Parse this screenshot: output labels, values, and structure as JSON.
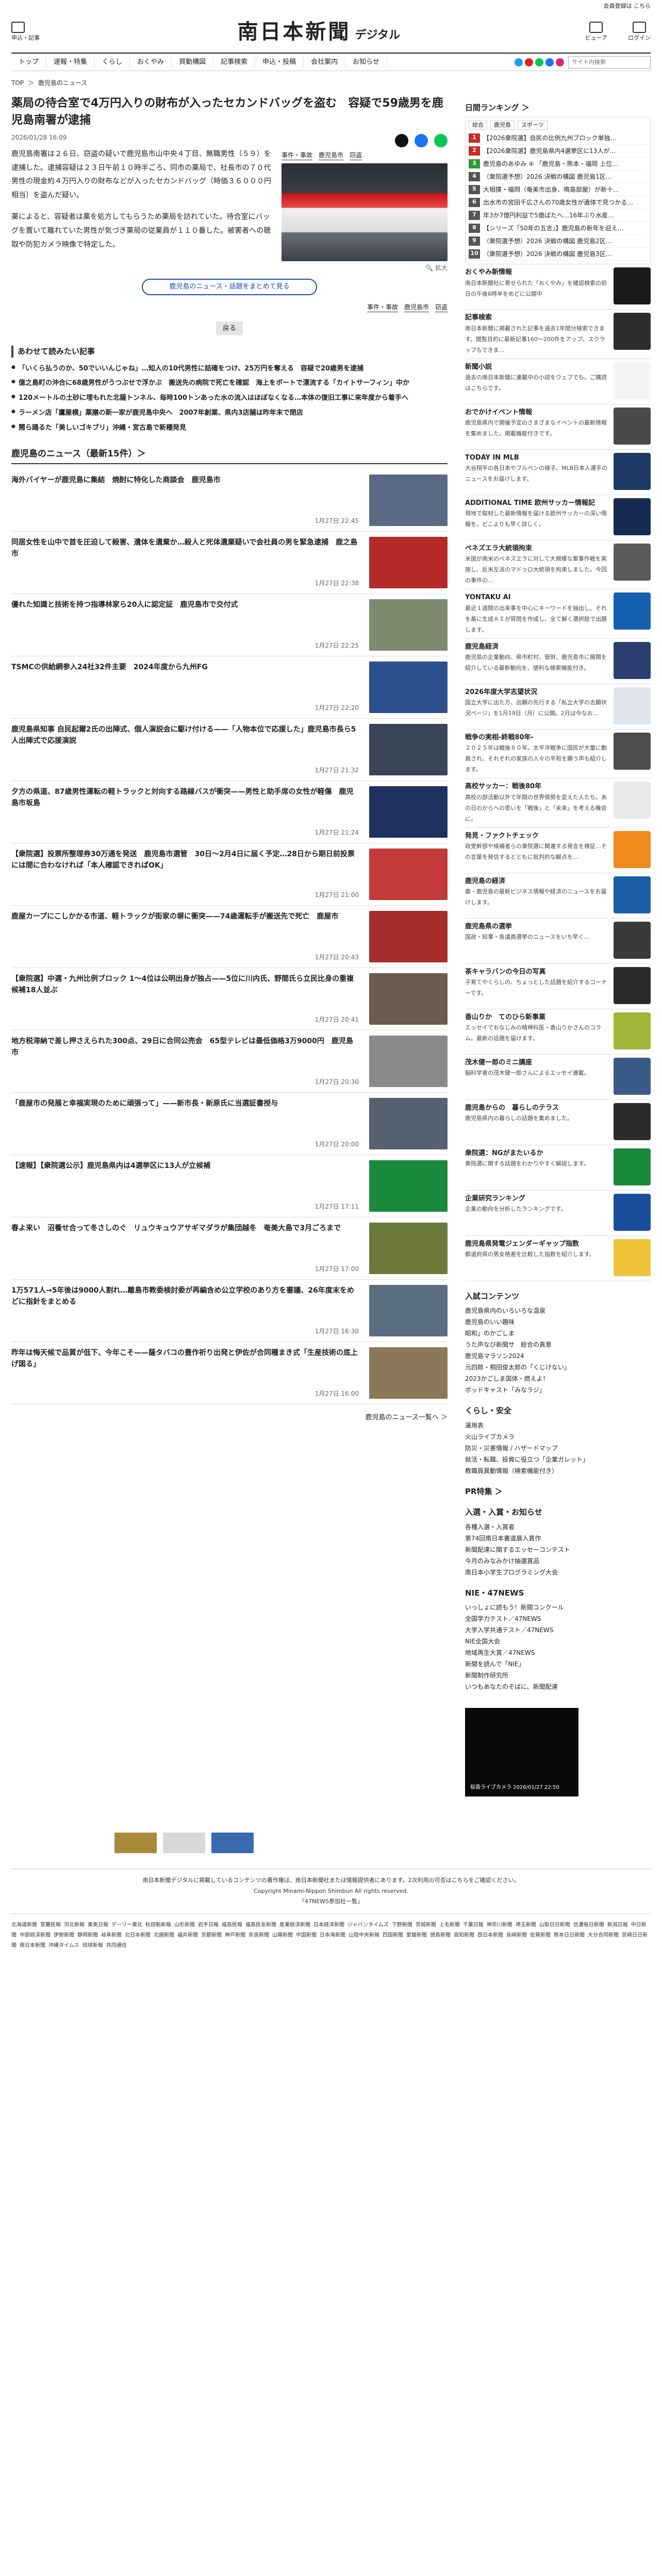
{
  "topbar": {
    "link": "会員登録は こちら"
  },
  "header": {
    "menu_label": "申込・記事",
    "logo_main": "南日本新聞",
    "logo_sub": "デジタル",
    "right1": "ビューア",
    "right2": "ログイン"
  },
  "nav": [
    "トップ",
    "速報・特集",
    "くらし",
    "おくやみ",
    "買動構図",
    "記事検索",
    "申込・投稿",
    "会社案内",
    "お知らせ"
  ],
  "search": {
    "placeholder": "サイト内検索"
  },
  "breadcrumb": [
    "TOP",
    "鹿児島のニュース"
  ],
  "article": {
    "title": "薬局の待合室で4万円入りの財布が入ったセカンドバッグを盗む　容疑で59歳男を鹿児島南署が逮捕",
    "date": "2026/01/28 16:09",
    "p1": "鹿児島南署は２６日、窃盗の疑いで鹿児島市山中央４丁目、無職男性（５９）を逮捕した。逮捕容疑は２３日午前１０時半ごろ、同市の薬局で、社長市の７０代男性の現金約４万円入りの財布などが入ったセカンドバッグ（時価３６０００円相当）を盗んだ疑い。",
    "p2": "薬によると、容疑者は薬を処方してもらうため薬局を訪れていた。待合室にバッグを置いて離れていた男性が気づき薬局の従業員が１１０番した。被害者への聴取や防犯カメラ映像で特定した。",
    "photo_tags": [
      "事件・事故",
      "鹿児島市",
      "窃盗"
    ],
    "enlarge": "拡大",
    "pill": "鹿児島のニュース・話題をまとめて見る",
    "bottom_tags": [
      "事件・事故",
      "鹿児島市",
      "窃盗"
    ],
    "back": "戻る"
  },
  "related": {
    "heading": "あわせて読みたい記事",
    "items": [
      "「いくら払うのか、50でいいんじゃね」…知人の10代男性に詰確をつけ、25万円を奪える　容疑で20歳男を逮捕",
      "億之島町の沖合に68歳男性がうつぶせで浮かぶ　搬送先の病院で死亡を確認　海上をボートで漂流する「カイトサーフィン」中か",
      "120メートルの土砂に埋もれた北薩トンネル、毎時100トンあった水の流入はほぼなくなる…本体の復旧工事に来年度から着手へ",
      "ラーメン店「鷹屋横」薬膳の新一家が鹿児島中央へ　2007年創業、県内3店舗は昨年末で閉店",
      "鬧ら踊るた「美しいゴキブリ」沖縄・宮古島で新種発見"
    ]
  },
  "news": {
    "heading": "鹿児島のニュース（最新15件）＞",
    "items": [
      {
        "title": "海外バイヤーが鹿児島に集結　焼酎に特化した商談会　鹿児島市",
        "date": "1月27日 22:45",
        "color": "#5a6a84"
      },
      {
        "title": "同居女性を山中で首を圧迫して殺害、遺体を遺棄か…殺人と死体遺棄疑いで会社員の男を緊急逮捕　鹿之島市",
        "date": "1月27日 22:38",
        "color": "#b72a2a"
      },
      {
        "title": "優れた知識と技術を持つ指導林家ら20人に認定証　鹿児島市で交付式",
        "date": "1月27日 22:25",
        "color": "#7c8a6e"
      },
      {
        "title": "TSMCの供給網参入24社32件主要　2024年度から九州FG",
        "date": "1月27日 22:20",
        "color": "#2a4f8c"
      },
      {
        "title": "鹿児島県知事 自民起爾2氏の出陣式、個人演説会に駆け付ける——「人物本位で応援した」鹿児島市長ら5人出陣式で応援演説",
        "date": "1月27日 21:32",
        "color": "#3a4658"
      },
      {
        "title": "夕方の県道、87歳男性運転の軽トラックと対向する路線バスが衝突——男性と助手席の女性が軽傷　鹿児島市坂島",
        "date": "1月27日 21:24",
        "color": "#1f3160"
      },
      {
        "title": "【衆院選】投票所整理券30万通を発送　鹿児島市選管　30日〜2月4日に届く予定…28日から期日前投票には間に合わなければ「本人確認できればOK」",
        "date": "1月27日 21:00",
        "color": "#c43a3a"
      },
      {
        "title": "鹿屋カープにこしかかる市道、軽トラックが街家の塀に衝突——74歳運転手が搬送先で死亡　鹿屋市",
        "date": "1月27日 20:43",
        "color": "#a72d2d"
      },
      {
        "title": "【衆院選】中選・九州比例ブロック 1〜4位は公明出身が独占——5位に川内氏、野間氏ら立民比身の重複候補18人並ぶ",
        "date": "1月27日 20:41",
        "color": "#6a5c4e"
      },
      {
        "title": "地方税滞納で差し押さえられた300点、29日に合同公売会　65型テレビは最低価格3万9000円　鹿児島市",
        "date": "1月27日 20:30",
        "color": "#8a8a8a"
      },
      {
        "title": "「鹿屋市の発展と幸福実現のために頑張って」——新市長・新原氏に当選証書授与",
        "date": "1月27日 20:00",
        "color": "#556070"
      },
      {
        "title": "【速報】【衆院選公示】鹿児島県内は4選挙区に13人が立候補",
        "date": "1月27日 17:11",
        "color": "#1c8a3c"
      },
      {
        "title": "春よ来い　沼養せ合って冬さしのぐ　リュウキュウアサギマダラが集団越冬　奄美大島で3月ごろまで",
        "date": "1月27日 17:00",
        "color": "#6e7a3c"
      },
      {
        "title": "1万571人→5年後は9000人割れ…離島市教委検討委が再編含め公立学校のあり方を審議、26年度末をめどに指針をまとめる",
        "date": "1月27日 16:30",
        "color": "#5a6e82"
      },
      {
        "title": "昨年は悔天候で品質が低下、今年こそ——薩タバコの豊作祈り出発と伊佐が合同種まき式「生産技術の底上げ図る」",
        "date": "1月27日 16:00",
        "color": "#8a7858"
      }
    ],
    "more": "鹿児島のニュース一覧へ ＞"
  },
  "sidebar": {
    "ranking_title": "日間ランキング ＞",
    "ranking_tabs": [
      "総合",
      "鹿児島",
      "スポーツ"
    ],
    "ranking": [
      {
        "n": "1",
        "t": "【2026衆院選】自民の比例九州ブロック単独…",
        "c": "#c82b2b"
      },
      {
        "n": "2",
        "t": "【2026衆院選】鹿児島県内4選挙区に13人が…",
        "c": "#c82b2b"
      },
      {
        "n": "3",
        "t": "鹿児島のあゆみ ④ 「鹿児島・熊本・福岡 上位…",
        "c": "#2c9a3a"
      },
      {
        "n": "4",
        "t": "（衆院選予想）2026 決戦の構図 鹿児島1区…",
        "c": "#555555"
      },
      {
        "n": "5",
        "t": "大相撲・福岡（奄美市出身、鳴島部屋）が新十…",
        "c": "#555555"
      },
      {
        "n": "6",
        "t": "出水市の宮田千広さんの70歳女性が遺体で見つかる…",
        "c": "#555555"
      },
      {
        "n": "7",
        "t": "年3か7億円利益で5億ぱたへ…16年ぶり水産…",
        "c": "#555555"
      },
      {
        "n": "8",
        "t": "【シリーズ「50年の五言」】鹿児島の新年を迎え…",
        "c": "#555555"
      },
      {
        "n": "9",
        "t": "（衆院選予想）2026 決戦の構図 鹿児島2区…",
        "c": "#555555"
      },
      {
        "n": "10",
        "t": "（衆院選予想）2026 決戦の構図 鹿児島3区…",
        "c": "#555555"
      }
    ],
    "boxes": [
      {
        "title": "おくやみ新情報",
        "text": "南日本新聞社に寄せられた「おくやみ」を確認検索の前日の午後6時半をめどに公開中",
        "color": "#1a1a1a"
      },
      {
        "title": "記事検索",
        "text": "南日本新聞に掲載された記事を過去1年間分検索できます。閲覧目的に最新記事160〜200件をアップ。スクラップもできま…",
        "color": "#2d2d2d"
      },
      {
        "title": "新聞小説",
        "text": "過去の南日本新聞に連載中の小説をウェブでも。ご購読はこちらです。",
        "color": "#f4f4f4"
      },
      {
        "title": "おでかけイベント情報",
        "text": "鹿児島県内で開催予定のさまざまなイベントの最新情報を集めました。掲載機能付きです。",
        "color": "#4a4a4a"
      },
      {
        "title": "TODAY IN MLB",
        "text": "大谷翔平の各日本やブルペンの様子、MLB日本人選手のニュースをお届けします。",
        "color": "#1e3a66"
      },
      {
        "title": "ADDITIONAL TIME 欧州サッカー情報記",
        "text": "現地で取材した最新情報を届ける欧州サッカーの深い情報を、どこよりも早く詳しく。",
        "color": "#142a50"
      },
      {
        "title": "ペネズエラ大統領拘束",
        "text": "米国が南米のベネズエラに対して大規模な軍事作戦を実施し、反米左派のマドゥロ大統領を拘束しました。今回の事件の…",
        "color": "#5a5a5a"
      },
      {
        "title": "YONTAKU AI",
        "text": "最近１週間の出来事を中心にキーワードを抽出し、それを基に生成ＡＩが質問を作成し、全て解く選択肢で出題します。",
        "color": "#1560b0"
      },
      {
        "title": "鹿児島経済",
        "text": "鹿児島の企業動向、県市町村、管財、鹿児島市に展開を紹介している最新動向を、便利な検索機能付き。",
        "color": "#2a3e72"
      },
      {
        "title": "2026年度大学志望状況",
        "text": "国立大学に出た方、出願の先行する「私立大学の志願状況ページ」を1月19日（月）に公開。2月は今なお…",
        "color": "#e0e4ea"
      },
      {
        "title": "戦争の実相-終戦80年-",
        "text": "２０２５年は戦後８０年。太平洋戦争に国民が大量に動員され、それぞれの家族の人々の平和を願う声も紹介します。",
        "color": "#4e4e4e"
      },
      {
        "title": "高校サッカー：戦後80年",
        "text": "高校の部活動以外で年間の世界情勢を変えた人たち。あの日のからへの思いを「戦後」と「未来」を考える機会に。",
        "color": "#e9e9e9"
      },
      {
        "title": "発見・ファクトチェック",
        "text": "政党幹部や候補者らの衆院選に関連する発言を検証…その言葉を発信するとともに批判的な観点を…",
        "color": "#f08a1a"
      },
      {
        "title": "鹿児島の経済",
        "text": "鹿・鹿児島の最新ビジネス情報や経済のニュースをお届けします。",
        "color": "#1a5fa8"
      },
      {
        "title": "鹿児島県の選挙",
        "text": "国政・知事・各議員選挙のニュースをいち早く…",
        "color": "#3a3a3a"
      },
      {
        "title": "茶キャラバンの今日の写真",
        "text": "子育てやくらしの、ちょっとした話題を紹介するコーナーです。",
        "color": "#2a2a2a"
      },
      {
        "title": "香山りか　てのひら新事業",
        "text": "エッセイでおなじみの精神科医・香山りかさんのコラム。最新の話題を届けます。",
        "color": "#a3b63a"
      },
      {
        "title": "茂木健一郎のミニ講座",
        "text": "脳科学者の茂木健一郎さんによるエッセイ連載。",
        "color": "#3a5a8a"
      },
      {
        "title": "鹿児島からの　暮らしのテラス",
        "text": "鹿児島県内の暮らしの話題を集めました。",
        "color": "#2b2b2b"
      },
      {
        "title": "衆院選：NGがまたいるか",
        "text": "衆院選に関する話題をわかりやすく解説します。",
        "color": "#1c8a3c"
      },
      {
        "title": "企業研究ランキング",
        "text": "企業の動向を分析したランキングです。",
        "color": "#1a4e9a"
      },
      {
        "title": "鹿児島県発電ジェンダーギャップ指数",
        "text": "都道府県の男女格差を比較した指数を紹介します。",
        "color": "#f0c23a"
      }
    ],
    "lists": [
      {
        "title": "入試コンテンツ",
        "items": [
          "鹿児島県内のいろいろな温泉",
          "鹿児島のいい趣味",
          "昭和」のかごしま",
          "うた声なび新聞サ　総合の真意",
          "鹿児島マラソン2024",
          "元四郎・桐田俊太郎の「くじけない」",
          "2023かごしま国体・燃えよ！",
          "ポッドキャスト「みなラジ」"
        ]
      },
      {
        "title": "くらし・安全",
        "items": [
          "運用表",
          "火山ライブカメラ",
          "防災・災害情報 / ハザードマップ",
          "就活・転職、投資に役立つ「企業ガレット」",
          "教職員異動情報（検索機能付き）"
        ]
      },
      {
        "title": "PR特集 ＞",
        "items": []
      },
      {
        "title": "入選・入賞・お知らせ",
        "items": [
          "各種入選・入賞者",
          "第74回南日本書道展入賞作",
          "新聞配達に関するエッセーコンテスト",
          "今月のみなみかけ抽選賞品",
          "南日本小学生プログラミング大会"
        ]
      },
      {
        "title": "NIE・47NEWS",
        "items": [
          "いっしょに読もう！新聞コンクール",
          "全国学力テスト／47NEWS",
          "大学入学共通テスト／47NEWS",
          "NIE全国大会",
          "地域再生大賞／47NEWS",
          "新聞を読んで「NIE」",
          "新聞制作研究所",
          "いつもあなたのそばに、新聞配達"
        ]
      }
    ],
    "video_caption": "桜島ライブカメラ 2026/01/27 22:50"
  },
  "footer": {
    "line1": "南日本新聞デジタルに掲載しているコンテンツの著作権は、南日本新聞社または情報提供者にあります。2次利用の可否はこちらをご確認ください。",
    "line2": "Copyright Minami-Nippon Shimbun All rights reserved.",
    "line3": "「47NEWS参加社一覧」",
    "links": [
      "北海道新聞",
      "室蘭民報",
      "河北新報",
      "東奥日報",
      "デーリー東北",
      "秋田魁新報",
      "山形新聞",
      "岩手日報",
      "福島民報",
      "福島民友新聞",
      "産業経済新聞",
      "日本経済新聞",
      "ジャパンタイムズ",
      "下野新聞",
      "茨城新聞",
      "上毛新聞",
      "千葉日報",
      "神奈川新聞",
      "埼玉新聞",
      "山梨日日新聞",
      "信濃毎日新聞",
      "新潟日報",
      "中日新聞",
      "中部経済新聞",
      "伊勢新聞",
      "静岡新聞",
      "岐阜新聞",
      "北日本新聞",
      "北國新聞",
      "福井新聞",
      "京都新聞",
      "神戸新聞",
      "奈良新聞",
      "山陽新聞",
      "中国新聞",
      "日本海新聞",
      "山陰中央新報",
      "四国新聞",
      "愛媛新聞",
      "徳島新聞",
      "高知新聞",
      "西日本新聞",
      "長崎新聞",
      "佐賀新聞",
      "熊本日日新聞",
      "大分合同新聞",
      "宮崎日日新聞",
      "南日本新聞",
      "沖縄タイムス",
      "琉球新報",
      "共同通信"
    ]
  }
}
